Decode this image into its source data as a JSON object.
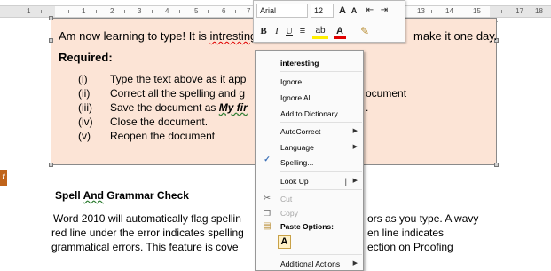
{
  "ruler": {
    "numbers": [
      "1",
      "1",
      "2",
      "3",
      "4",
      "5",
      "6",
      "7",
      "13",
      "14",
      "15",
      "17",
      "18"
    ]
  },
  "document": {
    "line1_before": "Am now learning to type! It is ",
    "line1_error_word": "intresting",
    "line1_after": "make it one day.",
    "required_label": "Required:",
    "list": [
      {
        "num": "(i)",
        "text": "Type the text above as it app"
      },
      {
        "num": "(ii)",
        "text": "Correct all the spelling and g",
        "tail": "ocument"
      },
      {
        "num": "(iii)",
        "text": "Save the document as ",
        "italic": "My fir",
        "tail": "."
      },
      {
        "num": "(iv)",
        "text": "Close the document."
      },
      {
        "num": "(v)",
        "text": "Reopen the document"
      }
    ],
    "heading_part1": "Spell ",
    "heading_part2": "And",
    "heading_part3": " Grammar Check",
    "para_line1": "Word 2010 will automatically flag spellin",
    "para_line1_tail": "ors as you type.  A wavy",
    "para_line2": "red line under the error indicates spelling",
    "para_line2_tail": "en line indicates",
    "para_line3": "grammatical errors.  This feature is cove",
    "para_line3_tail": "ection on Proofing",
    "side_icon_letter": "t"
  },
  "minibar": {
    "font": "Arial",
    "size": "12",
    "grow_font": "A",
    "shrink_font": "A",
    "bold": "B",
    "italic": "I",
    "underline": "U",
    "font_color": "A"
  },
  "context_menu": {
    "suggestion": "interesting",
    "ignore": "Ignore",
    "ignore_all": "Ignore All",
    "add_to_dictionary": "Add to Dictionary",
    "autocorrect": "AutoCorrect",
    "language": "Language",
    "spelling": "Spelling...",
    "look_up": "Look Up",
    "cut": "Cut",
    "copy": "Copy",
    "paste_options": "Paste Options:",
    "paste_keep": "A",
    "additional_actions": "Additional Actions"
  },
  "colors": {
    "box_fill": "#fce4d6",
    "error_underline": "#e00000",
    "grammar_underline": "#2e7d32"
  }
}
